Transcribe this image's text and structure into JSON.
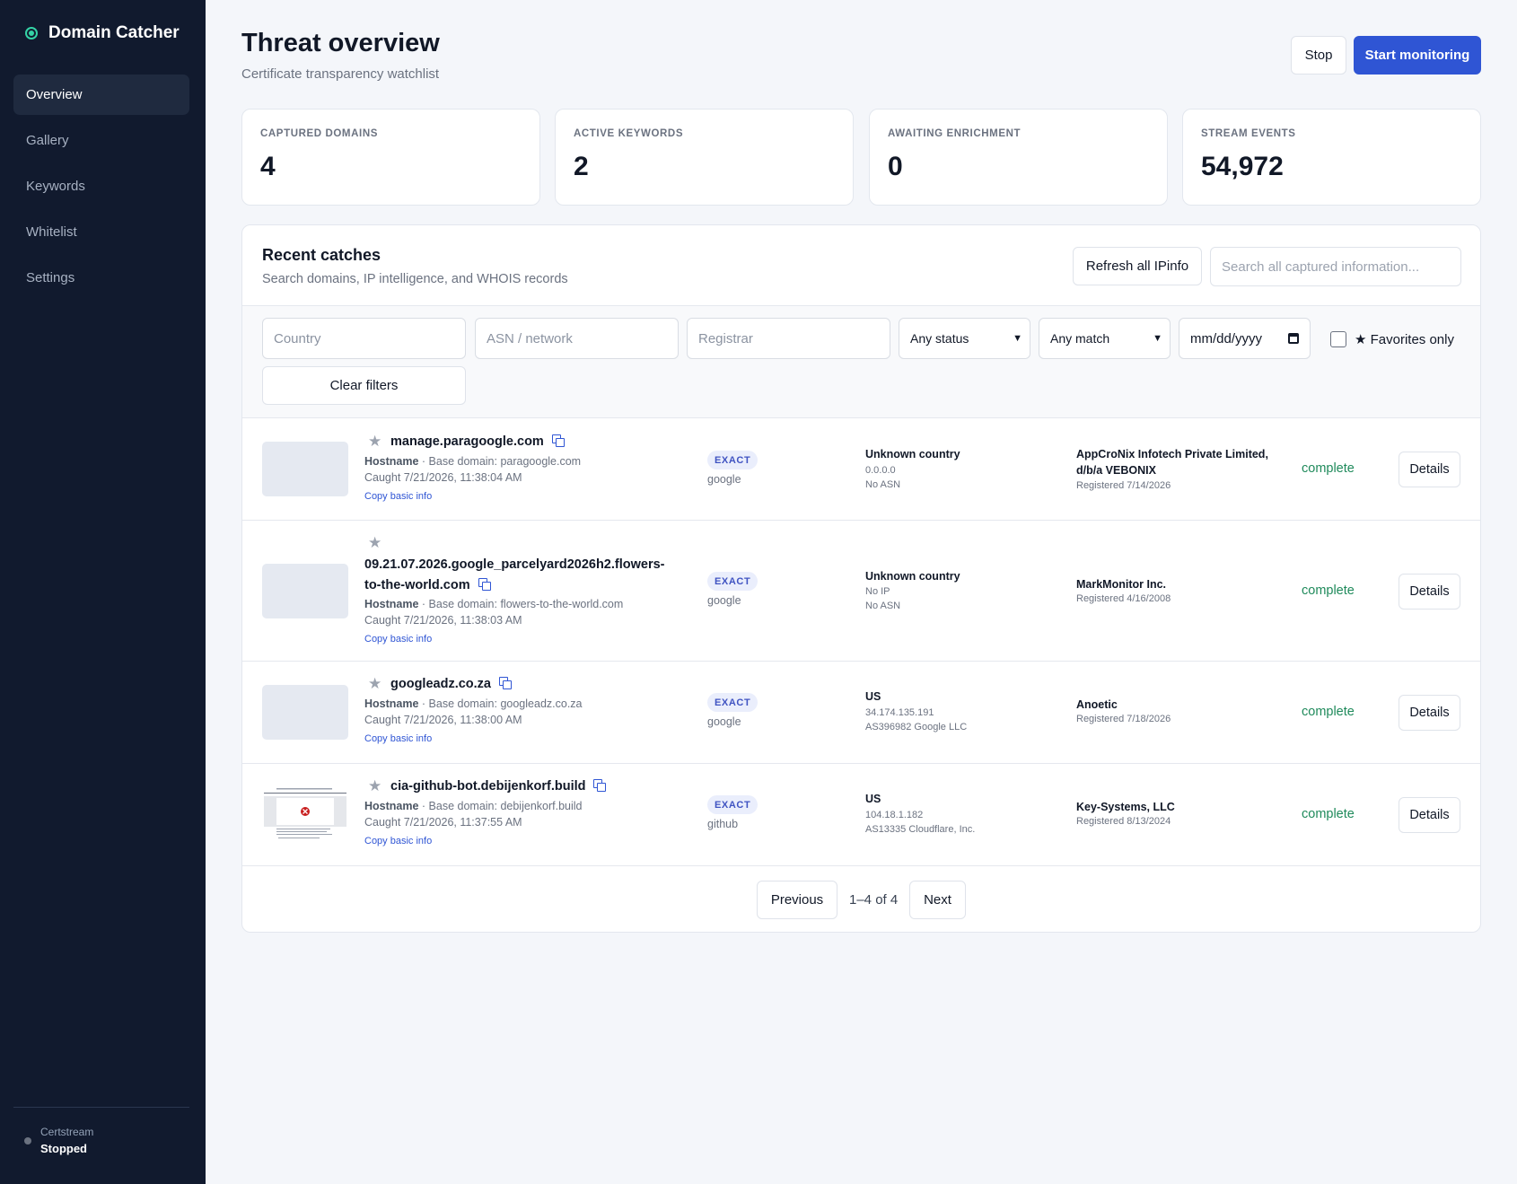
{
  "app": {
    "name": "Domain Catcher"
  },
  "sidebar": {
    "items": [
      {
        "label": "Overview"
      },
      {
        "label": "Gallery"
      },
      {
        "label": "Keywords"
      },
      {
        "label": "Whitelist"
      },
      {
        "label": "Settings"
      }
    ],
    "active": "Overview",
    "footer": {
      "label": "Certstream",
      "status": "Stopped"
    }
  },
  "header": {
    "title": "Threat overview",
    "subtitle": "Certificate transparency watchlist",
    "stop_label": "Stop",
    "start_label": "Start monitoring"
  },
  "stats": [
    {
      "label": "CAPTURED DOMAINS",
      "value": "4"
    },
    {
      "label": "ACTIVE KEYWORDS",
      "value": "2"
    },
    {
      "label": "AWAITING ENRICHMENT",
      "value": "0"
    },
    {
      "label": "STREAM EVENTS",
      "value": "54,972"
    }
  ],
  "catches": {
    "title": "Recent catches",
    "subtitle": "Search domains, IP intelligence, and WHOIS records",
    "refresh_label": "Refresh all IPinfo",
    "search_placeholder": "Search all captured information...",
    "filters": {
      "country_placeholder": "Country",
      "asn_placeholder": "ASN / network",
      "registrar_placeholder": "Registrar",
      "status_value": "Any status",
      "match_value": "Any match",
      "date_placeholder": "mm/dd/yyyy",
      "favorites_label": "★ Favorites only",
      "clear_label": "Clear filters"
    },
    "rows": [
      {
        "domain": "manage.paragoogle.com",
        "type": "Hostname",
        "base": " · Base domain: paragoogle.com",
        "caught": "Caught 7/21/2026, 11:38:04 AM",
        "copy": "Copy basic info",
        "match": "EXACT",
        "keyword": "google",
        "country": "Unknown country",
        "ip": "0.0.0.0",
        "asn": "No ASN",
        "registrar": "AppCroNix Infotech Private Limited, d/b/a VEBONIX",
        "registered": "Registered 7/14/2026",
        "status": "complete",
        "details": "Details"
      },
      {
        "domain": "09.21.07.2026.google_parcelyard2026h2.flowers-to-the-world.com",
        "type": "Hostname",
        "base": " · Base domain: flowers-to-the-world.com",
        "caught": "Caught 7/21/2026, 11:38:03 AM",
        "copy": "Copy basic info",
        "match": "EXACT",
        "keyword": "google",
        "country": "Unknown country",
        "ip": "No IP",
        "asn": "No ASN",
        "registrar": "MarkMonitor Inc.",
        "registered": "Registered 4/16/2008",
        "status": "complete",
        "details": "Details"
      },
      {
        "domain": "googleadz.co.za",
        "type": "Hostname",
        "base": " · Base domain: googleadz.co.za",
        "caught": "Caught 7/21/2026, 11:38:00 AM",
        "copy": "Copy basic info",
        "match": "EXACT",
        "keyword": "google",
        "country": "US",
        "ip": "34.174.135.191",
        "asn": "AS396982 Google LLC",
        "registrar": "Anoetic",
        "registered": "Registered 7/18/2026",
        "status": "complete",
        "details": "Details"
      },
      {
        "domain": "cia-github-bot.debijenkorf.build",
        "type": "Hostname",
        "base": " · Base domain: debijenkorf.build",
        "caught": "Caught 7/21/2026, 11:37:55 AM",
        "copy": "Copy basic info",
        "match": "EXACT",
        "keyword": "github",
        "country": "US",
        "ip": "104.18.1.182",
        "asn": "AS13335 Cloudflare, Inc.",
        "registrar": "Key-Systems, LLC",
        "registered": "Registered 8/13/2024",
        "status": "complete",
        "details": "Details"
      }
    ],
    "pagination": {
      "prev": "Previous",
      "info": "1–4 of 4",
      "next": "Next"
    }
  },
  "colors": {
    "sidebar_bg": "#111a2e",
    "accent": "#2f55d4",
    "status_complete": "#1f8a5b",
    "brand_dot": "#34d3a6"
  }
}
